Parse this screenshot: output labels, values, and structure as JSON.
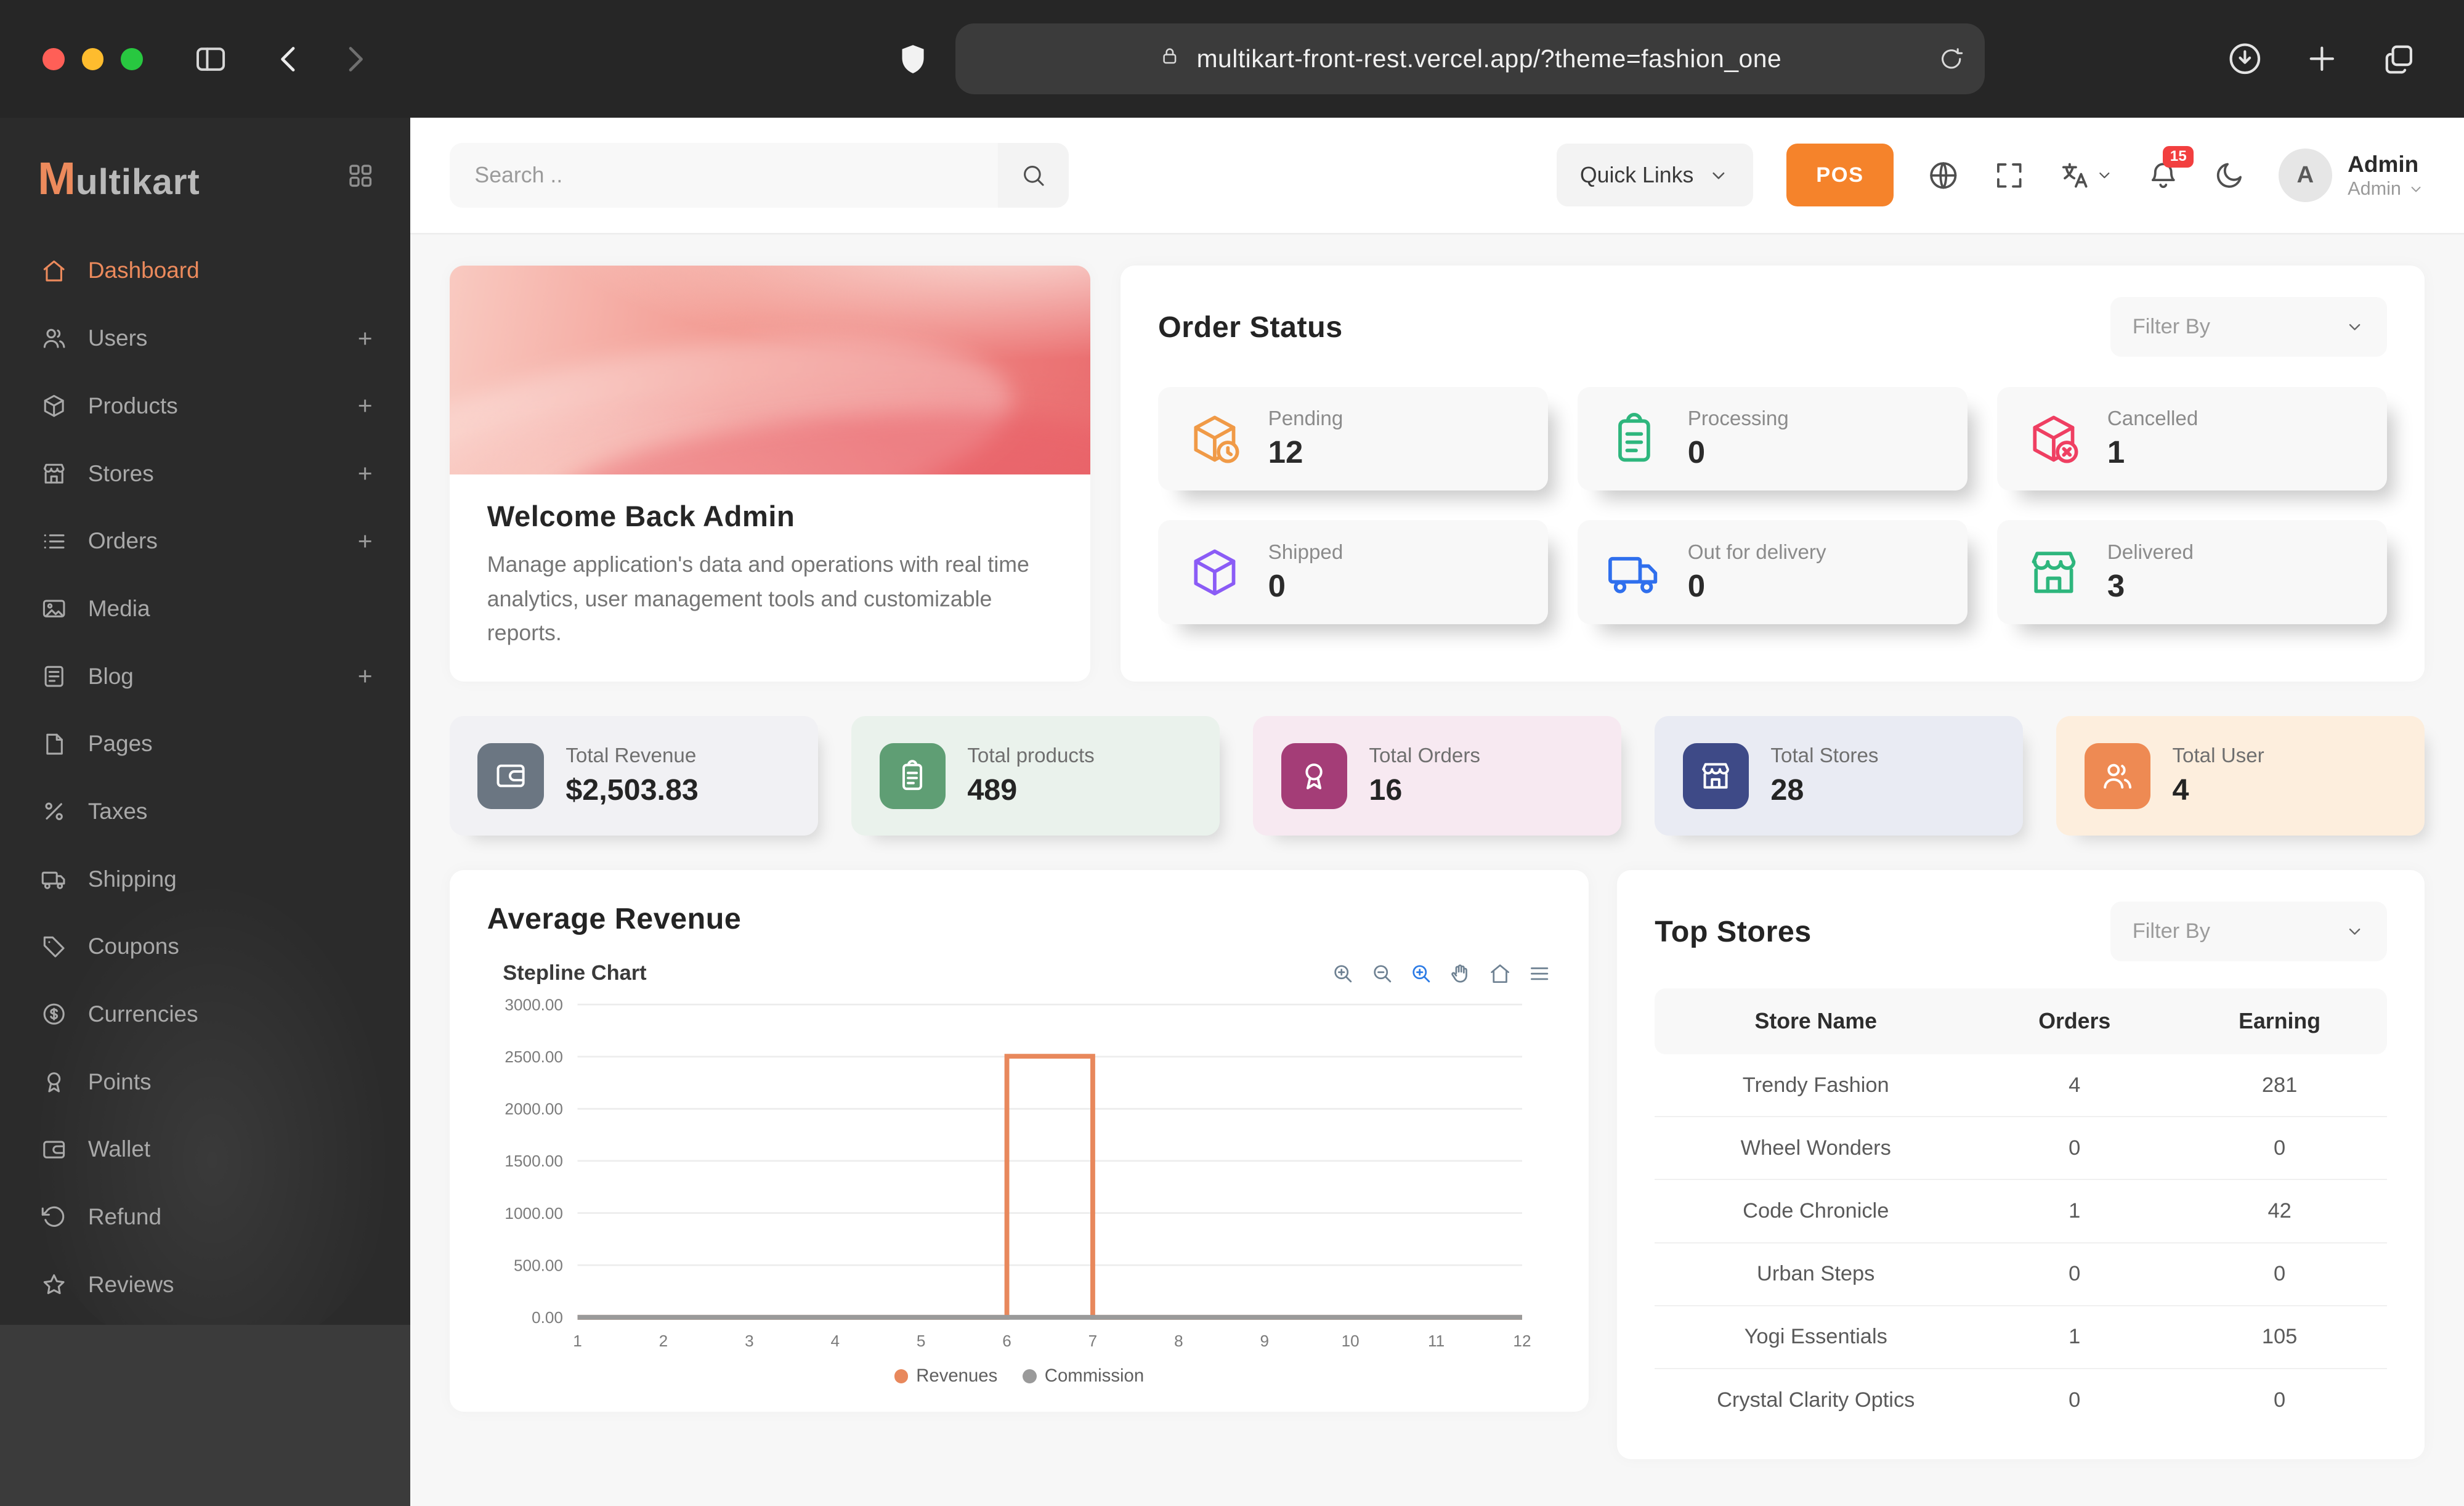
{
  "browser": {
    "url": "multikart-front-rest.vercel.app/?theme=fashion_one"
  },
  "sidebar": {
    "logo": {
      "m": "M",
      "rest": "ultikart"
    },
    "plus_glyph": "+",
    "items": [
      {
        "label": "Dashboard",
        "icon": "home-icon",
        "active": true
      },
      {
        "label": "Users",
        "icon": "users-icon",
        "plus": true
      },
      {
        "label": "Products",
        "icon": "box-icon",
        "plus": true
      },
      {
        "label": "Stores",
        "icon": "store-icon",
        "plus": true
      },
      {
        "label": "Orders",
        "icon": "list-icon",
        "plus": true
      },
      {
        "label": "Media",
        "icon": "media-icon"
      },
      {
        "label": "Blog",
        "icon": "blog-icon",
        "plus": true
      },
      {
        "label": "Pages",
        "icon": "pages-icon"
      },
      {
        "label": "Taxes",
        "icon": "percent-icon"
      },
      {
        "label": "Shipping",
        "icon": "truck-icon"
      },
      {
        "label": "Coupons",
        "icon": "tag-icon"
      },
      {
        "label": "Currencies",
        "icon": "dollar-icon"
      },
      {
        "label": "Points",
        "icon": "award-icon"
      },
      {
        "label": "Wallet",
        "icon": "wallet-icon"
      },
      {
        "label": "Refund",
        "icon": "refund-icon"
      },
      {
        "label": "Reviews",
        "icon": "star-icon"
      }
    ]
  },
  "header": {
    "search_placeholder": "Search ..",
    "quick_links_label": "Quick Links",
    "pos_label": "POS",
    "notification_count": "15",
    "avatar_letter": "A",
    "user_name": "Admin",
    "user_role": "Admin"
  },
  "welcome": {
    "title": "Welcome Back Admin",
    "description": "Manage application's data and operations with real time analytics, user management tools and customizable reports."
  },
  "order_status": {
    "title": "Order Status",
    "filter_placeholder": "Filter By",
    "tiles": [
      {
        "label": "Pending",
        "value": "12",
        "icon": "cube-clock-icon",
        "color": "#f09a47"
      },
      {
        "label": "Processing",
        "value": "0",
        "icon": "clipboard-icon",
        "color": "#2eb67d"
      },
      {
        "label": "Cancelled",
        "value": "1",
        "icon": "cube-x-icon",
        "color": "#ef3f62"
      },
      {
        "label": "Shipped",
        "value": "0",
        "icon": "cube-icon",
        "color": "#8b5cf6"
      },
      {
        "label": "Out for delivery",
        "value": "0",
        "icon": "truck-icon",
        "color": "#2f6fed"
      },
      {
        "label": "Delivered",
        "value": "3",
        "icon": "storefront-icon",
        "color": "#2eb67d"
      }
    ]
  },
  "stats": [
    {
      "label": "Total Revenue",
      "value": "$2,503.83",
      "icon": "wallet-icon",
      "icon_bg": "#6b7682",
      "card_bg": "#f1f1f4"
    },
    {
      "label": "Total products",
      "value": "489",
      "icon": "clipboard-icon",
      "icon_bg": "#5f9e74",
      "card_bg": "#eaf2ec"
    },
    {
      "label": "Total Orders",
      "value": "16",
      "icon": "award-icon",
      "icon_bg": "#a43d77",
      "card_bg": "#f7e9f1"
    },
    {
      "label": "Total Stores",
      "value": "28",
      "icon": "storefront-icon",
      "icon_bg": "#3e4a87",
      "card_bg": "#e9ebf3"
    },
    {
      "label": "Total User",
      "value": "4",
      "icon": "users-icon",
      "icon_bg": "#ee8a53",
      "card_bg": "#fdeedd"
    }
  ],
  "chart_card": {
    "title": "Average Revenue",
    "subtitle": "Stepline Chart"
  },
  "chart_data": {
    "type": "line",
    "step": true,
    "title": "Stepline Chart",
    "x": [
      1,
      2,
      3,
      4,
      5,
      6,
      7,
      8,
      9,
      10,
      11,
      12
    ],
    "ylim": [
      0,
      3000
    ],
    "yticks": [
      0,
      500,
      1000,
      1500,
      2000,
      2500,
      3000
    ],
    "ytick_labels": [
      "0.00",
      "500.00",
      "1000.00",
      "1500.00",
      "2000.00",
      "2500.00",
      "3000.00"
    ],
    "grid": true,
    "legend_position": "bottom",
    "series": [
      {
        "name": "Revenues",
        "color": "#e8885c",
        "values": [
          0,
          0,
          0,
          0,
          0,
          2503.83,
          0,
          0,
          0,
          0,
          0,
          0
        ]
      },
      {
        "name": "Commission",
        "color": "#9a9a9a",
        "values": [
          0,
          0,
          0,
          0,
          0,
          0,
          0,
          0,
          0,
          0,
          0,
          0
        ]
      }
    ]
  },
  "top_stores": {
    "title": "Top Stores",
    "filter_placeholder": "Filter By",
    "columns": [
      "Store Name",
      "Orders",
      "Earning"
    ],
    "rows": [
      [
        "Trendy Fashion",
        "4",
        "281"
      ],
      [
        "Wheel Wonders",
        "0",
        "0"
      ],
      [
        "Code Chronicle",
        "1",
        "42"
      ],
      [
        "Urban Steps",
        "0",
        "0"
      ],
      [
        "Yogi Essentials",
        "1",
        "105"
      ],
      [
        "Crystal Clarity Optics",
        "0",
        "0"
      ]
    ]
  },
  "colors": {
    "accent_orange": "#ec8a5c",
    "pos_orange": "#f5832b",
    "badge_red": "#f23f3f",
    "sidebar_bg": "#2b2b2b",
    "page_bg": "#f7f7f7"
  }
}
